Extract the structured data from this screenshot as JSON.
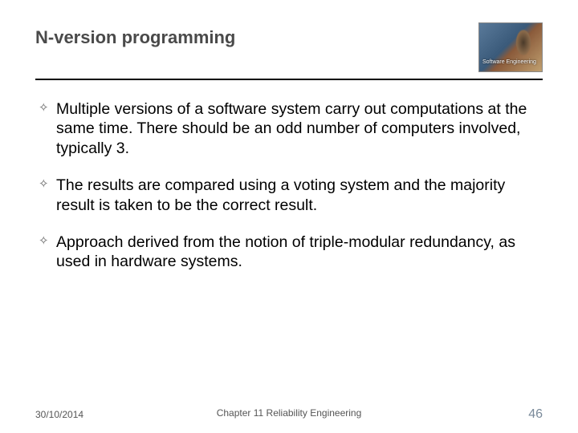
{
  "slide": {
    "title": "N-version programming",
    "logo": {
      "label": "Software Engineering",
      "sub": ""
    },
    "bullets": [
      "Multiple versions of a software system carry out computations at the same time. There should be an odd number of computers involved, typically 3.",
      "The results are compared using a voting system and the majority result is taken to be the correct result.",
      "Approach derived from the notion of triple-modular redundancy, as used in hardware systems."
    ],
    "footer": {
      "date": "30/10/2014",
      "center": "Chapter 11 Reliability Engineering",
      "page": "46"
    }
  }
}
